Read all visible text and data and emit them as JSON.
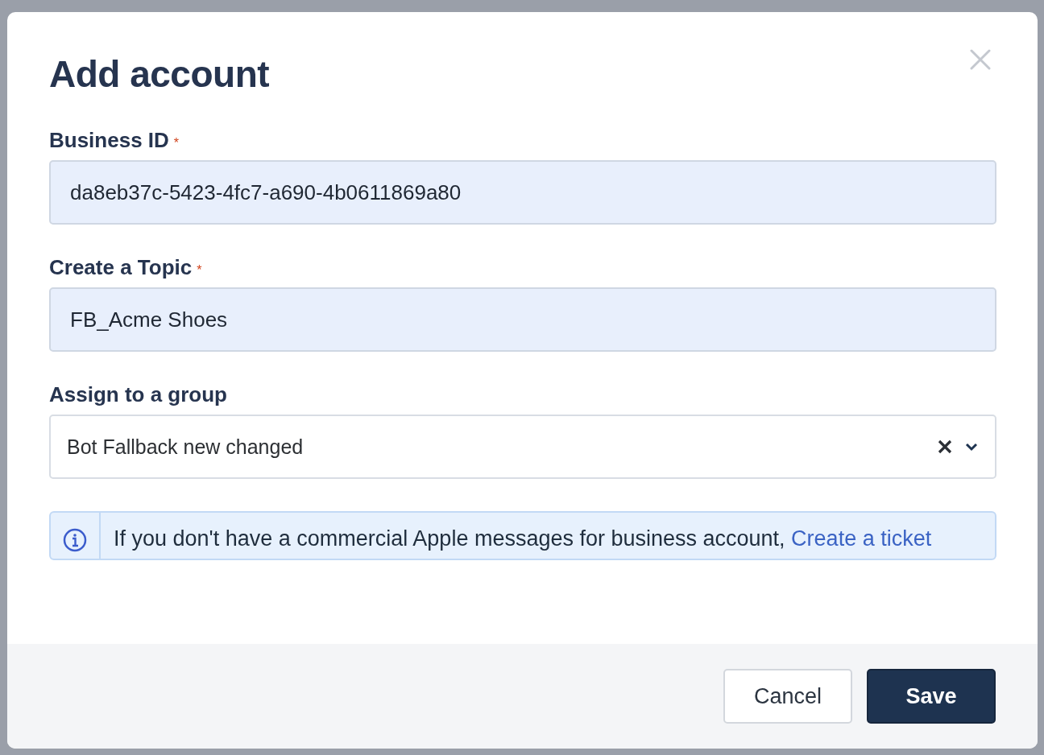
{
  "dialog": {
    "title": "Add account",
    "fields": [
      {
        "kind": "text",
        "label": "Business ID",
        "required_mark": "*",
        "value": "da8eb37c-5423-4fc7-a690-4b0611869a80"
      },
      {
        "kind": "text",
        "label": "Create a Topic",
        "required_mark": "*",
        "value": "FB_Acme Shoes"
      },
      {
        "kind": "select",
        "label": "Assign to a group",
        "value": "Bot Fallback new changed"
      }
    ],
    "info": {
      "text": "If you don't have a commercial Apple messages for business account, ",
      "link": "Create a ticket"
    },
    "buttons": [
      {
        "label": "Cancel",
        "kind": "secondary"
      },
      {
        "label": "Save",
        "kind": "primary"
      }
    ]
  }
}
